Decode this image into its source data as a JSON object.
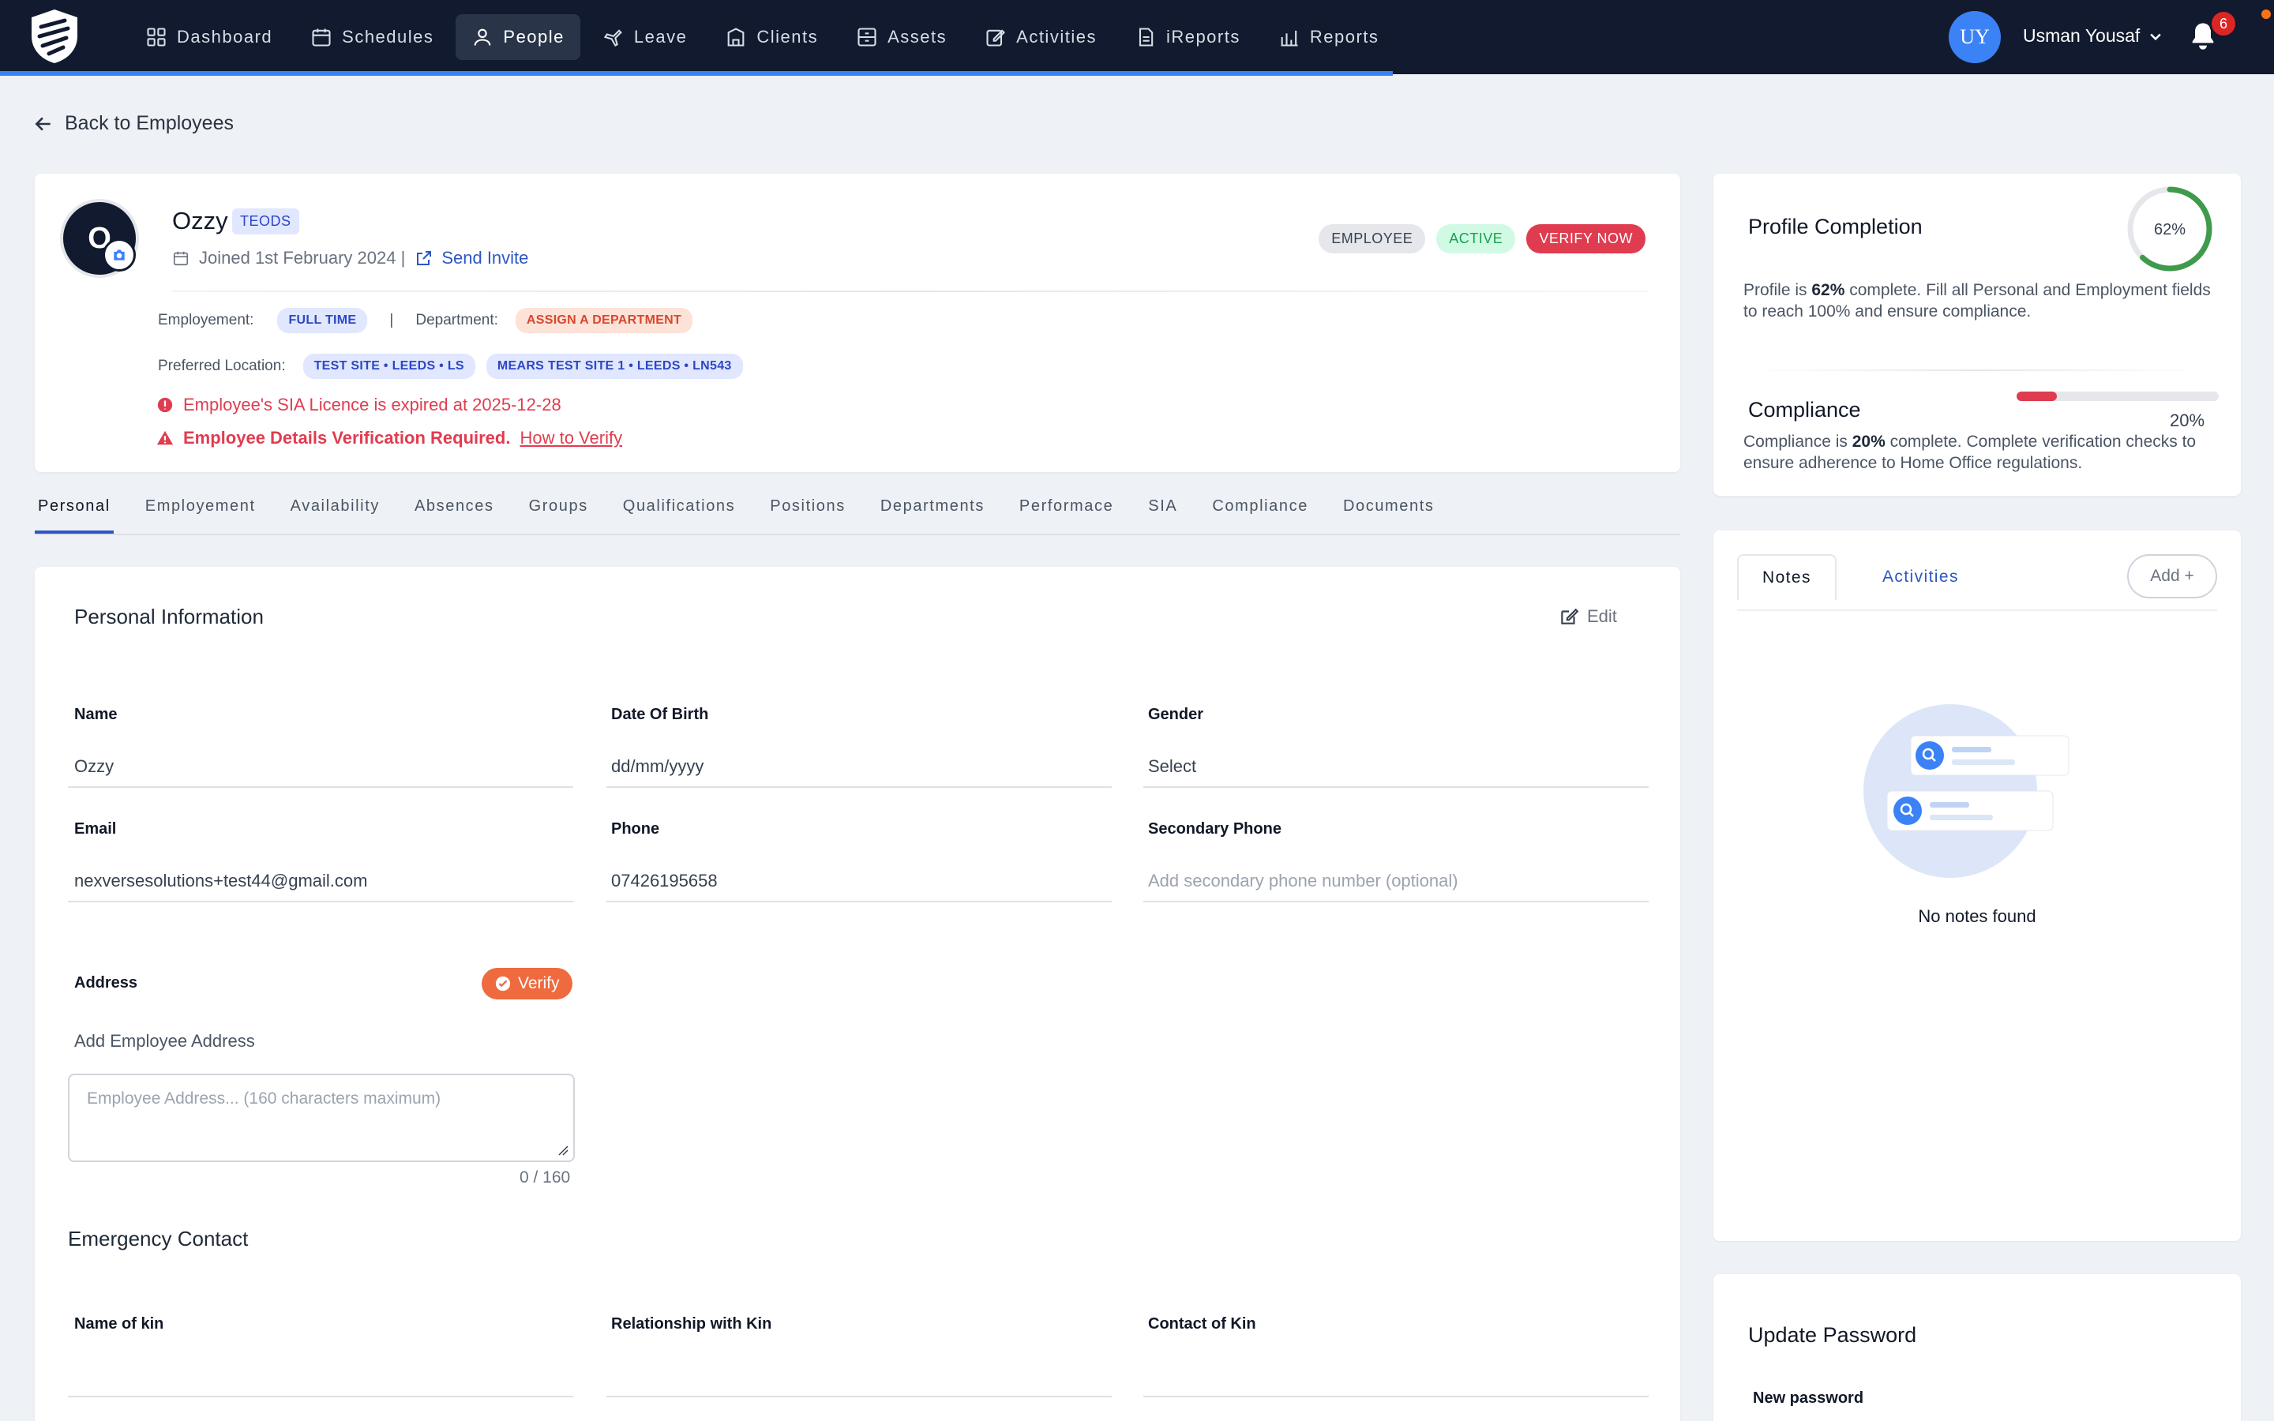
{
  "nav": {
    "items": [
      {
        "label": "Dashboard",
        "icon": "dashboard-icon",
        "active": false
      },
      {
        "label": "Schedules",
        "icon": "calendar-icon",
        "active": false
      },
      {
        "label": "People",
        "icon": "people-icon",
        "active": true
      },
      {
        "label": "Leave",
        "icon": "plane-icon",
        "active": false
      },
      {
        "label": "Clients",
        "icon": "building-icon",
        "active": false
      },
      {
        "label": "Assets",
        "icon": "box-icon",
        "active": false
      },
      {
        "label": "Activities",
        "icon": "edit-icon",
        "active": false
      },
      {
        "label": "iReports",
        "icon": "document-icon",
        "active": false
      },
      {
        "label": "Reports",
        "icon": "bar-chart-icon",
        "active": false
      }
    ],
    "user_initials": "UY",
    "user_name": "Usman Yousaf",
    "notification_count": "6"
  },
  "back_link": "Back to Employees",
  "profile": {
    "avatar_text": "O",
    "name": "Ozzy",
    "tag": "TEODS",
    "joined": "Joined 1st February 2024 |",
    "send_invite": "Send Invite",
    "pills": {
      "employee": "EMPLOYEE",
      "status": "ACTIVE",
      "verify": "VERIFY NOW"
    },
    "employment_label": "Employement:",
    "employment_value": "FULL TIME",
    "separator": "|",
    "department_label": "Department:",
    "department_value": "ASSIGN A DEPARTMENT",
    "location_label": "Preferred Location:",
    "locations": [
      "TEST SITE • LEEDS • LS",
      "MEARS TEST SITE 1 • LEEDS • LN543"
    ],
    "alert_licence": "Employee's SIA Licence is expired at 2025-12-28",
    "alert_verification": "Employee Details Verification Required.",
    "alert_how": "How to Verify"
  },
  "tabs": [
    "Personal",
    "Employement",
    "Availability",
    "Absences",
    "Groups",
    "Qualifications",
    "Positions",
    "Departments",
    "Performace",
    "SIA",
    "Compliance",
    "Documents"
  ],
  "personal": {
    "title": "Personal Information",
    "edit": "Edit",
    "name_label": "Name",
    "name_value": "Ozzy",
    "dob_label": "Date Of Birth",
    "dob_value": "dd/mm/yyyy",
    "gender_label": "Gender",
    "gender_value": "Select",
    "email_label": "Email",
    "email_value": "nexversesolutions+test44@gmail.com",
    "phone_label": "Phone",
    "phone_value": "07426195658",
    "sec_phone_label": "Secondary Phone",
    "sec_phone_placeholder": "Add secondary phone number (optional)",
    "address_label": "Address",
    "verify": "Verify",
    "address_sub": "Add Employee Address",
    "address_placeholder": "Employee Address... (160 characters maximum)",
    "address_counter": "0 / 160",
    "emergency_title": "Emergency Contact",
    "kin_name_label": "Name of kin",
    "kin_rel_label": "Relationship with Kin",
    "kin_contact_label": "Contact of Kin"
  },
  "completion": {
    "title": "Profile Completion",
    "percent": 62,
    "percent_label": "62%",
    "text_pre": "Profile is ",
    "text_bold": "62%",
    "text_post": " complete. Fill all Personal and Employment fields to reach 100% and ensure compliance."
  },
  "compliance": {
    "title": "Compliance",
    "percent": 20,
    "percent_label": "20%",
    "text_pre": "Compliance is ",
    "text_bold": "20%",
    "text_post": " complete. Complete verification checks to ensure adherence to Home Office regulations."
  },
  "notes": {
    "tab_notes": "Notes",
    "tab_activities": "Activities",
    "add": "Add +",
    "empty": "No notes found"
  },
  "password": {
    "title": "Update Password",
    "new_label": "New password"
  },
  "colors": {
    "nav_bg": "#111a2e",
    "accent": "#2d56c4",
    "danger": "#e03c50",
    "success": "#16a34a",
    "orange": "#ef6a3f"
  }
}
